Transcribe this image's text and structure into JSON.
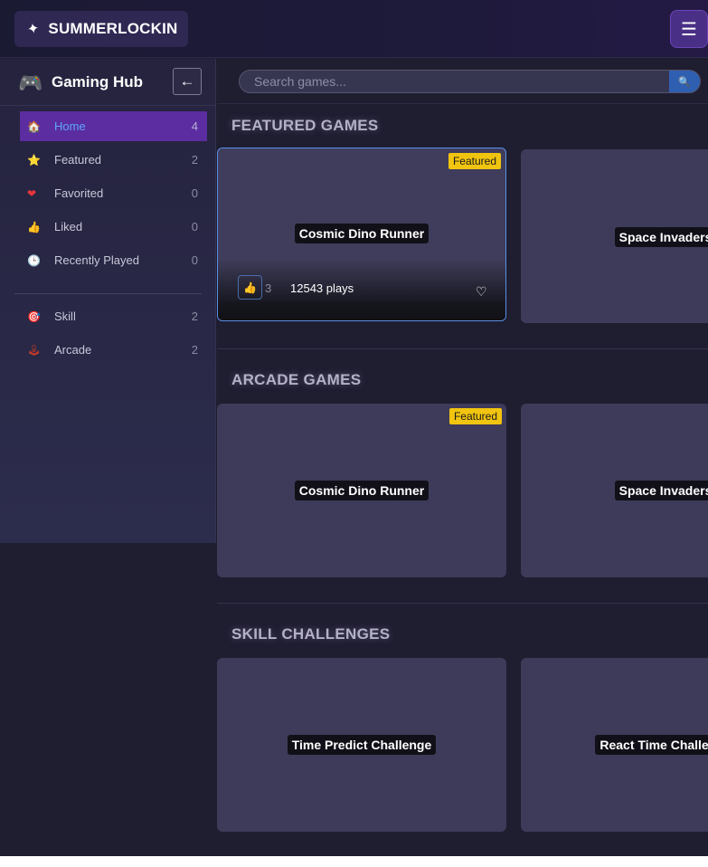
{
  "brand": {
    "icon": "sparkle-icon",
    "name": "SUMMERLOCKIN"
  },
  "topbar": {
    "menu_icon": "hamburger-menu-icon",
    "menu_glyph": "☰"
  },
  "sidebar": {
    "title": "Gaming Hub",
    "logo_icon": "gamepad-icon",
    "collapse_glyph": "←",
    "nav": [
      {
        "label": "Home",
        "count": "4",
        "icon": "house-icon",
        "glyph": "🏠",
        "active": true
      },
      {
        "label": "Featured",
        "count": "2",
        "icon": "star-icon",
        "glyph": "⭐"
      },
      {
        "label": "Favorited",
        "count": "0",
        "icon": "heart-icon",
        "glyph": "❤"
      },
      {
        "label": "Liked",
        "count": "0",
        "icon": "thumbs-up-icon",
        "glyph": "👍"
      },
      {
        "label": "Recently Played",
        "count": "0",
        "icon": "clock-icon",
        "glyph": "🕒"
      }
    ],
    "categories": [
      {
        "label": "Skill",
        "count": "2",
        "icon": "target-icon",
        "glyph": "🎯"
      },
      {
        "label": "Arcade",
        "count": "2",
        "icon": "joystick-icon",
        "glyph": "🕹"
      }
    ]
  },
  "search": {
    "placeholder": "Search games...",
    "button_glyph": "🔍"
  },
  "sections": [
    {
      "title": "FEATURED GAMES",
      "cards": [
        {
          "title": "Cosmic Dino Runner",
          "badge": "Featured",
          "likes": "3",
          "plays": "12543 plays"
        },
        {
          "title": "Space Invaders"
        }
      ]
    },
    {
      "title": "ARCADE GAMES",
      "cards": [
        {
          "title": "Cosmic Dino Runner",
          "badge": "Featured"
        },
        {
          "title": "Space Invaders"
        }
      ]
    },
    {
      "title": "SKILL CHALLENGES",
      "cards": [
        {
          "title": "Time Predict Challenge"
        },
        {
          "title": "React Time Challenge"
        }
      ]
    }
  ],
  "colors": {
    "accent_purple": "#5b2da0",
    "active_text": "#5fa6ff",
    "badge_yellow": "#f1c40f",
    "background": "#1f1d30"
  }
}
